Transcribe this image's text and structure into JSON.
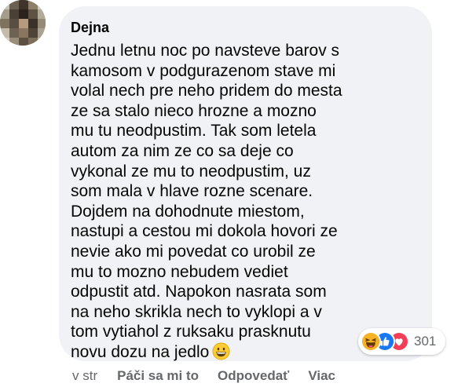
{
  "comment": {
    "author": "Dejna",
    "lines": [
      "Jednu letnu noc po navsteve barov s",
      "kamosom v podgurazenom stave mi",
      "volal nech pre neho pridem do mesta",
      "ze sa stalo nieco hrozne a mozno",
      "mu tu neodpustim. Tak som letela",
      "autom za nim ze co sa deje co",
      "vykonal ze mu to neodpustim, uz",
      "som mala v hlave rozne scenare.",
      "Dojdem na dohodnute miestom,",
      "nastupi a cestou mi dokola hovori ze",
      "nevie ako mi povedat co urobil ze",
      "mu to mozno nebudem vediet",
      "odpustit atd. Napokon nasrata som",
      "na neho skrikla nech to vyklopi a v",
      "tom vytiahol z ruksaku prasknutu",
      "novu dozu na jedlo"
    ],
    "trailing_emoji": "grinning-face-emoji"
  },
  "reactions": {
    "icons": [
      "haha-reaction-icon",
      "like-reaction-icon",
      "love-reaction-icon"
    ],
    "count": "301"
  },
  "actions": {
    "time": "v str",
    "like_label": "Páči sa mi to",
    "reply_label": "Odpovedať",
    "more_label": "Viac"
  },
  "colors": {
    "bubble_bg": "#f0f2f5",
    "text": "#050505",
    "secondary_text": "#65676b",
    "like_blue": "#1877f2",
    "love_red": "#f33e58",
    "haha_yellow": "#f7b125"
  }
}
